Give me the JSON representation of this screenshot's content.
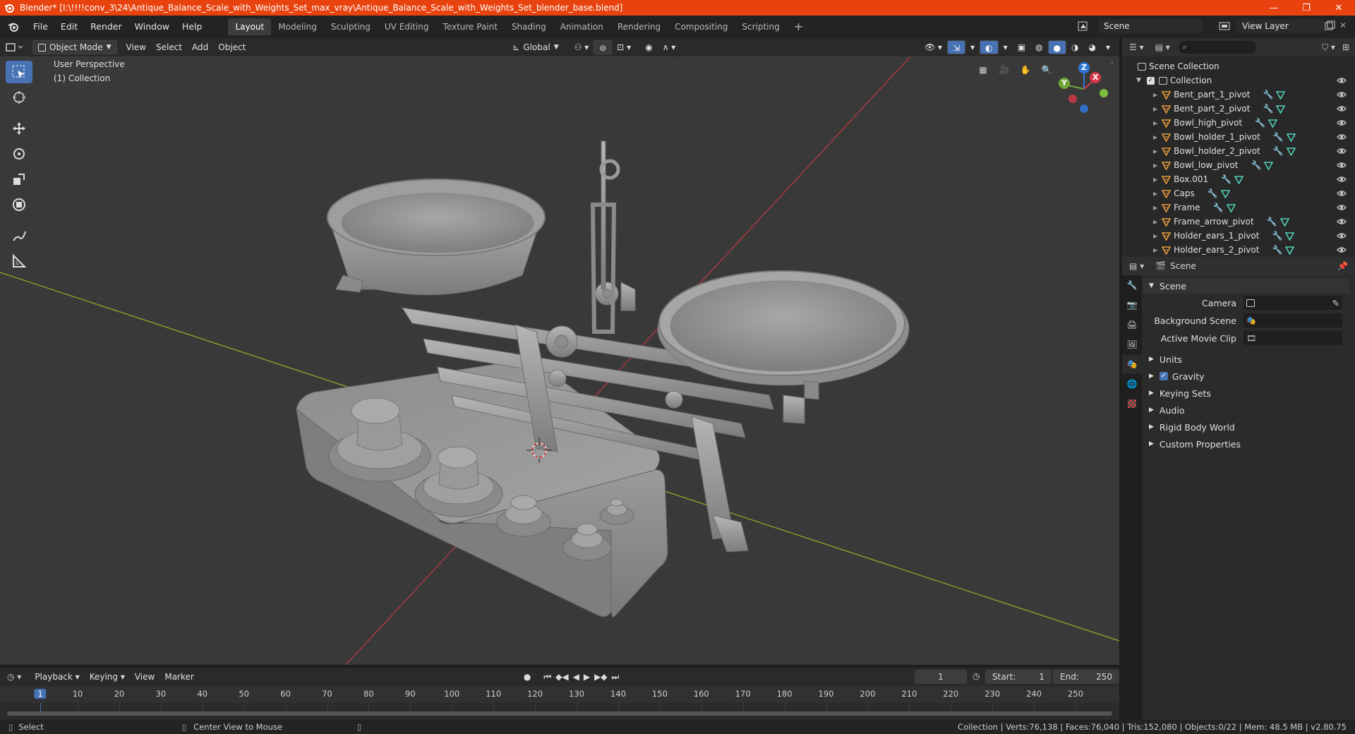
{
  "window": {
    "title": "Blender* [I:\\!!!!conv_3\\24\\Antique_Balance_Scale_with_Weights_Set_max_vray\\Antique_Balance_Scale_with_Weights_Set_blender_base.blend]",
    "minimize": "—",
    "maximize": "❐",
    "close": "✕"
  },
  "menu": [
    "File",
    "Edit",
    "Render",
    "Window",
    "Help"
  ],
  "workspaces": [
    "Layout",
    "Modeling",
    "Sculpting",
    "UV Editing",
    "Texture Paint",
    "Shading",
    "Animation",
    "Rendering",
    "Compositing",
    "Scripting"
  ],
  "workspace_add": "+",
  "scene_selector": "Scene",
  "view_layer": "View Layer",
  "viewport_header": {
    "mode": "Object Mode",
    "menus": [
      "View",
      "Select",
      "Add",
      "Object"
    ],
    "orientation": "Global"
  },
  "viewport": {
    "perspective": "User Perspective",
    "collection": "(1) Collection",
    "gizmo": {
      "z": "Z",
      "y": "Y",
      "x": "X"
    }
  },
  "outliner": {
    "root": "Scene Collection",
    "collection": "Collection",
    "items": [
      "Bent_part_1_pivot",
      "Bent_part_2_pivot",
      "Bowl_high_pivot",
      "Bowl_holder_1_pivot",
      "Bowl_holder_2_pivot",
      "Bowl_low_pivot",
      "Box.001",
      "Caps",
      "Frame",
      "Frame_arrow_pivot",
      "Holder_ears_1_pivot",
      "Holder_ears_2_pivot"
    ]
  },
  "properties": {
    "context": "Scene",
    "panel": "Scene",
    "camera_label": "Camera",
    "background_scene_label": "Background Scene",
    "active_movie_clip_label": "Active Movie Clip",
    "sections": [
      "Units",
      "Gravity",
      "Keying Sets",
      "Audio",
      "Rigid Body World",
      "Custom Properties"
    ]
  },
  "timeline": {
    "menus": [
      "Playback",
      "Keying",
      "View",
      "Marker"
    ],
    "current_frame": "1",
    "start_label": "Start:",
    "start": "1",
    "end_label": "End:",
    "end": "250",
    "ticks": [
      "1",
      "10",
      "20",
      "30",
      "40",
      "50",
      "60",
      "70",
      "80",
      "90",
      "100",
      "110",
      "120",
      "130",
      "140",
      "150",
      "160",
      "170",
      "180",
      "190",
      "200",
      "210",
      "220",
      "230",
      "240",
      "250"
    ]
  },
  "status": {
    "select": "Select",
    "center_view": "Center View to Mouse",
    "stats": "Collection | Verts:76,138 | Faces:76,040 | Tris:152,080 | Objects:0/22 | Mem: 48.5 MB | v2.80.75"
  }
}
